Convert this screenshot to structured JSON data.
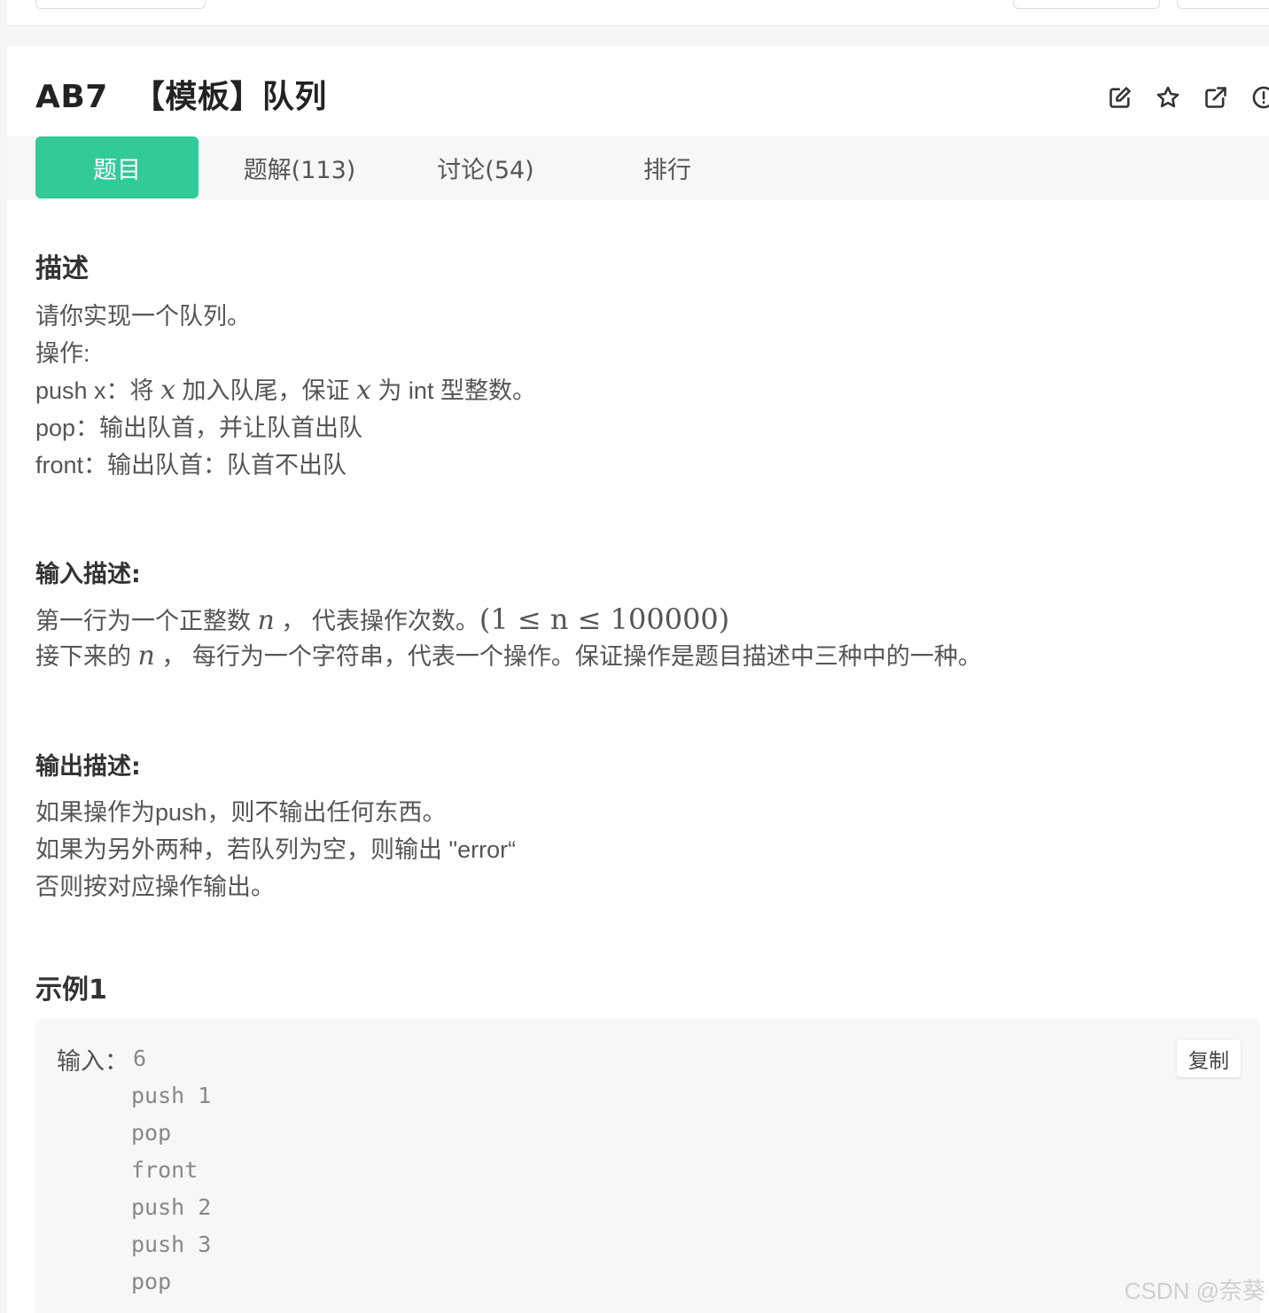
{
  "problem": {
    "code": "AB7",
    "title": "【模板】队列"
  },
  "header_icons": [
    "edit-icon",
    "star-icon",
    "external-link-icon",
    "info-icon"
  ],
  "tabs": [
    {
      "label": "题目",
      "active": true
    },
    {
      "label": "题解(113)",
      "active": false
    },
    {
      "label": "讨论(54)",
      "active": false
    },
    {
      "label": "排行",
      "active": false
    }
  ],
  "description": {
    "heading": "描述",
    "lines": {
      "l1": "请你实现一个队列。",
      "l2": "操作:",
      "l3_a": "push x：将 ",
      "l3_var": "x",
      "l3_b": " 加入队尾，保证 ",
      "l3_c": " 为 int 型整数。",
      "l4": "pop：输出队首，并让队首出队",
      "l5": "front：输出队首：队首不出队"
    }
  },
  "input_desc": {
    "heading": "输入描述:",
    "line1_a": "第一行为一个正整数 ",
    "var_n": "n",
    "line1_b": " ， 代表操作次数。",
    "line1_math": "(1 ≤ n ≤ 100000)",
    "line2_a": "接下来的 ",
    "line2_b": " ， 每行为一个字符串，代表一个操作。保证操作是题目描述中三种中的一种。"
  },
  "output_desc": {
    "heading": "输出描述:",
    "lines": [
      "如果操作为push，则不输出任何东西。",
      "如果为另外两种，若队列为空，则输出 \"error“",
      "否则按对应操作输出。"
    ]
  },
  "example": {
    "heading": "示例1",
    "input_label": "输入：",
    "lines": [
      "6",
      "push 1",
      "pop",
      "front",
      "push 2",
      "push 3",
      "pop"
    ],
    "copy_label": "复制"
  },
  "watermark": "CSDN @奈葵",
  "colors": {
    "accent": "#32ca99"
  }
}
